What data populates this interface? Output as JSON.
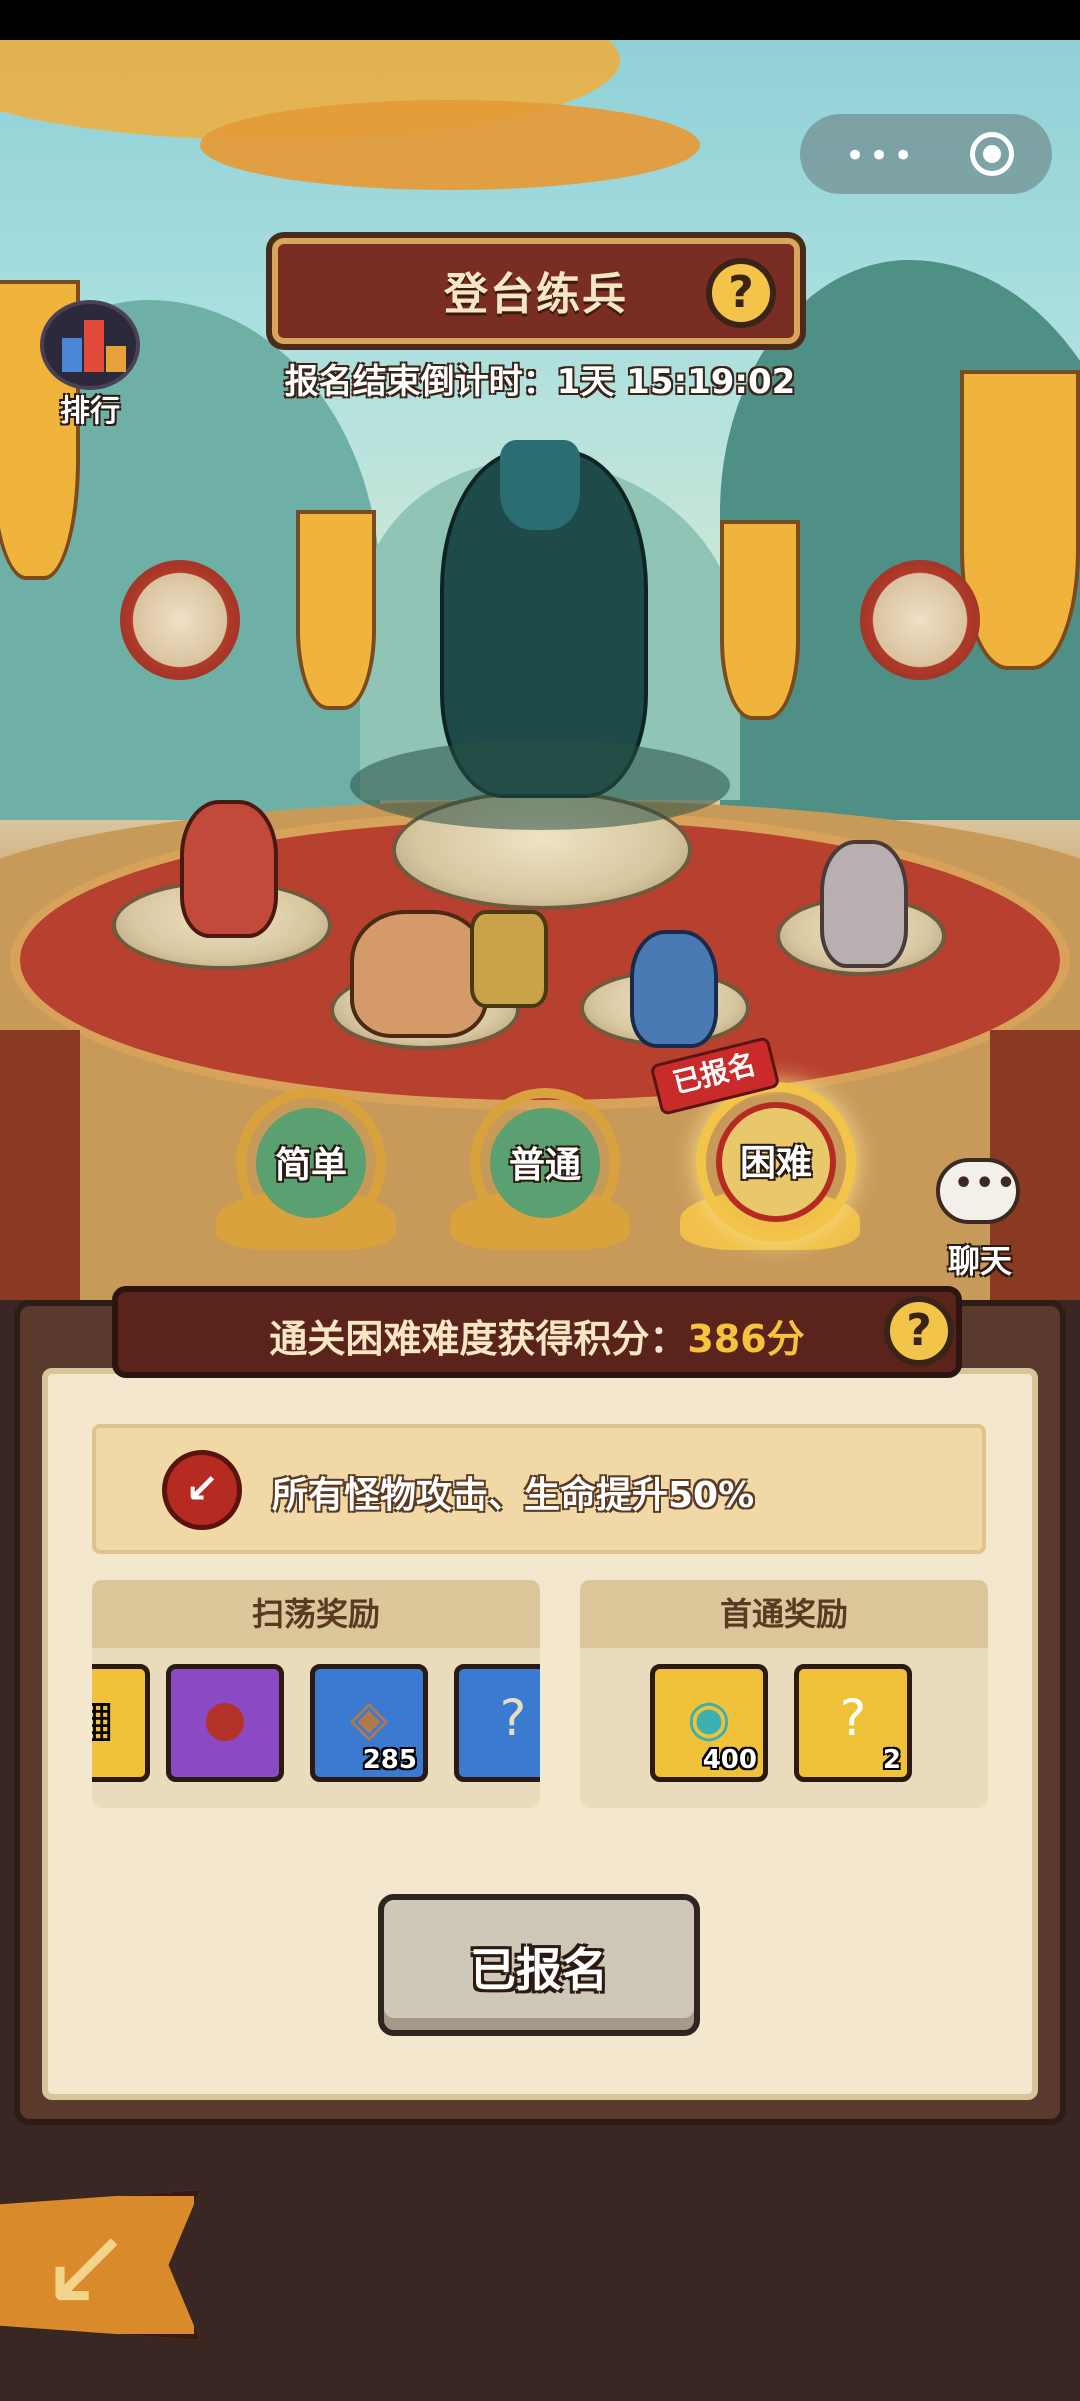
{
  "title": "登台练兵",
  "countdown": "报名结束倒计时：1天 15:19:02",
  "rank": {
    "label": "排行"
  },
  "chat": {
    "label": "聊天"
  },
  "capsule": {
    "more": "•••"
  },
  "difficulties": [
    {
      "label": "简单",
      "selected": false
    },
    {
      "label": "普通",
      "selected": false
    },
    {
      "label": "困难",
      "selected": true
    }
  ],
  "registered_tag": "已报名",
  "score": {
    "prefix": "通关困难难度获得积分：",
    "value": "386分"
  },
  "buff": "所有怪物攻击、生命提升50%",
  "sweep_rewards": {
    "title": "扫荡奖励",
    "items": [
      {
        "name": "chest-item",
        "count": ""
      },
      {
        "name": "wine-jar-item",
        "count": ""
      },
      {
        "name": "coin-item",
        "count": "285"
      },
      {
        "name": "scroll-item",
        "count": ""
      }
    ]
  },
  "first_clear_rewards": {
    "title": "首通奖励",
    "items": [
      {
        "name": "jade-dragon-item",
        "count": "400"
      },
      {
        "name": "mystery-chest-item",
        "count": "2"
      }
    ]
  },
  "register_button": "已报名",
  "help_symbol": "?",
  "colors": {
    "accent": "#f7c23c",
    "panel": "#f3e8ce",
    "selected_ring": "#b52b22"
  }
}
